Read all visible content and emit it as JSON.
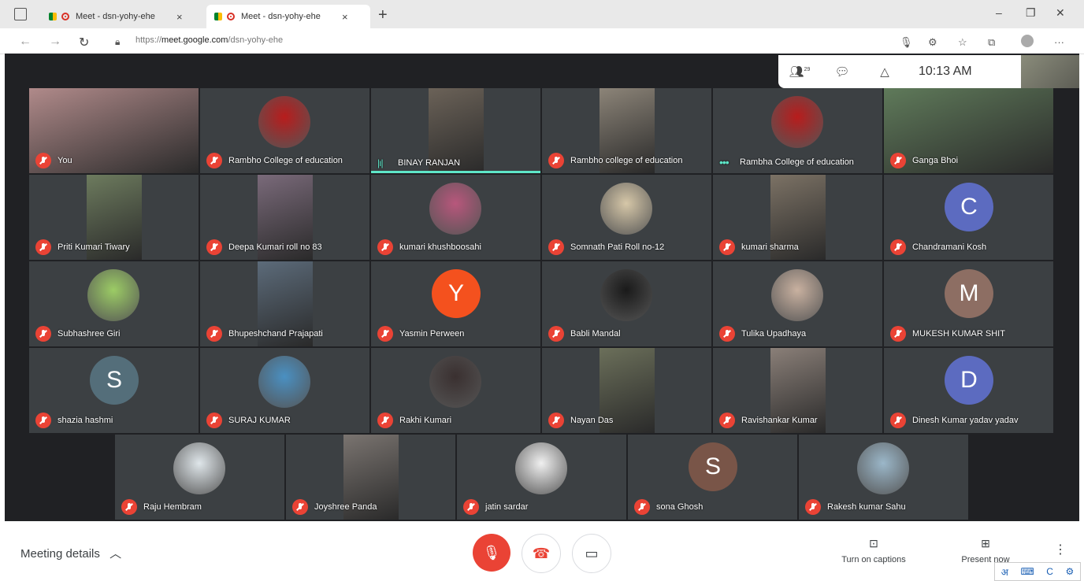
{
  "browser": {
    "tabs": [
      {
        "title": "Meet - dsn-yohy-ehe",
        "close": "×",
        "active": false
      },
      {
        "title": "Meet - dsn-yohy-ehe",
        "close": "×",
        "active": true
      }
    ],
    "new_tab": "+",
    "window_controls": {
      "minimize": "–",
      "maximize": "❐",
      "close": "✕"
    },
    "url_prefix": "https://",
    "url_host": "meet.google.com",
    "url_path": "/dsn-yohy-ehe"
  },
  "meet": {
    "topbar": {
      "people_count": "29",
      "time": "10:13 AM"
    },
    "participants": [
      {
        "name": "You",
        "type": "video",
        "status": "muted",
        "bg": "#b08a8a"
      },
      {
        "name": "Rambho College of education",
        "type": "image",
        "status": "muted",
        "bg": "#b81c1c"
      },
      {
        "name": "BINAY RANJAN",
        "type": "video",
        "status": "speaking",
        "bg": "#6b6258"
      },
      {
        "name": "Rambho college of education",
        "type": "video",
        "status": "muted",
        "bg": "#8c8478"
      },
      {
        "name": "Rambha College of education",
        "type": "image",
        "status": "dots",
        "bg": "#b81c1c"
      },
      {
        "name": "Ganga Bhoi",
        "type": "video",
        "status": "muted",
        "bg": "#5f7a5a"
      },
      {
        "name": "Priti Kumari Tiwary",
        "type": "video",
        "status": "muted",
        "bg": "#6d7b5e"
      },
      {
        "name": "Deepa Kumari roll no 83",
        "type": "video",
        "status": "muted",
        "bg": "#7a6a7a"
      },
      {
        "name": "kumari khushboosahi",
        "type": "image",
        "status": "muted",
        "bg": "#b8577c"
      },
      {
        "name": "Somnath Pati Roll no-12",
        "type": "image",
        "status": "muted",
        "bg": "#d6c7a8"
      },
      {
        "name": "kumari sharma",
        "type": "video",
        "status": "muted",
        "bg": "#7c7265"
      },
      {
        "name": "Chandramani Kosh",
        "type": "avatar",
        "initial": "C",
        "status": "muted",
        "bg": "#5c6bc0"
      },
      {
        "name": "Subhashree Giri",
        "type": "image",
        "status": "muted",
        "bg": "#9ccc65"
      },
      {
        "name": "Bhupeshchand Prajapati",
        "type": "video",
        "status": "muted",
        "bg": "#5c6b7a"
      },
      {
        "name": "Yasmin Perween",
        "type": "avatar",
        "initial": "Y",
        "status": "muted",
        "bg": "#f4511e"
      },
      {
        "name": "Babli Mandal",
        "type": "image",
        "status": "muted",
        "bg": "#1a1a1a"
      },
      {
        "name": "Tulika Upadhaya",
        "type": "image",
        "status": "muted",
        "bg": "#c9b1a0"
      },
      {
        "name": "MUKESH KUMAR SHIT",
        "type": "avatar",
        "initial": "M",
        "status": "muted",
        "bg": "#8d6e63"
      },
      {
        "name": "shazia hashmi",
        "type": "avatar",
        "initial": "S",
        "status": "muted",
        "bg": "#546e7a"
      },
      {
        "name": "SURAJ KUMAR",
        "type": "image",
        "status": "muted",
        "bg": "#4a90c2"
      },
      {
        "name": "Rakhi Kumari",
        "type": "image",
        "status": "muted",
        "bg": "#3a3030"
      },
      {
        "name": "Nayan Das",
        "type": "video",
        "status": "muted",
        "bg": "#6b6f5a"
      },
      {
        "name": "Ravishankar Kumar",
        "type": "video",
        "status": "muted",
        "bg": "#8a7f78"
      },
      {
        "name": "Dinesh Kumar yadav yadav",
        "type": "avatar",
        "initial": "D",
        "status": "muted",
        "bg": "#5c6bc0"
      },
      {
        "name": "Raju Hembram",
        "type": "image",
        "status": "muted",
        "bg": "#dfe6ea"
      },
      {
        "name": "Joyshree Panda",
        "type": "video",
        "status": "muted",
        "bg": "#7a7470"
      },
      {
        "name": "jatin sardar",
        "type": "image",
        "status": "muted",
        "bg": "#f0f0f0"
      },
      {
        "name": "sona Ghosh",
        "type": "avatar",
        "initial": "S",
        "status": "muted",
        "bg": "#795548"
      },
      {
        "name": "Rakesh kumar Sahu",
        "type": "image",
        "status": "muted",
        "bg": "#9bb7c9"
      }
    ]
  },
  "bottom": {
    "meeting_details": "Meeting details",
    "captions": "Turn on captions",
    "present": "Present now"
  },
  "ime": {
    "lang": "अ",
    "mode": "C"
  }
}
